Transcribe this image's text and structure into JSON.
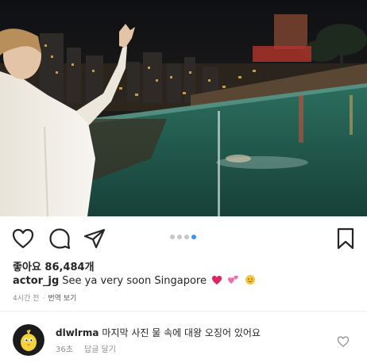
{
  "post": {
    "photo": {
      "alt_semantic": "night-pool-photo",
      "colors": {
        "sky": "#15161b",
        "pool": "#1f5d4f",
        "shirt": "#f2efe8"
      }
    },
    "likes_label": "좋아요 86,484개",
    "caption": {
      "username": "actor_jg",
      "text": "See ya very soon Singapore"
    },
    "time_ago": "4시간 전",
    "meta_separator": "·",
    "translate_label": "번역 보기",
    "carousel": {
      "count": 4,
      "active_index": 3
    },
    "icons": [
      "heart-icon",
      "comment-icon",
      "share-icon",
      "bookmark-icon"
    ]
  },
  "comment": {
    "username": "dlwlrma",
    "text": "마지막 사진 물 속에 대왕 오징어 있어요",
    "time": "36초",
    "reply_label": "답글 달기"
  }
}
